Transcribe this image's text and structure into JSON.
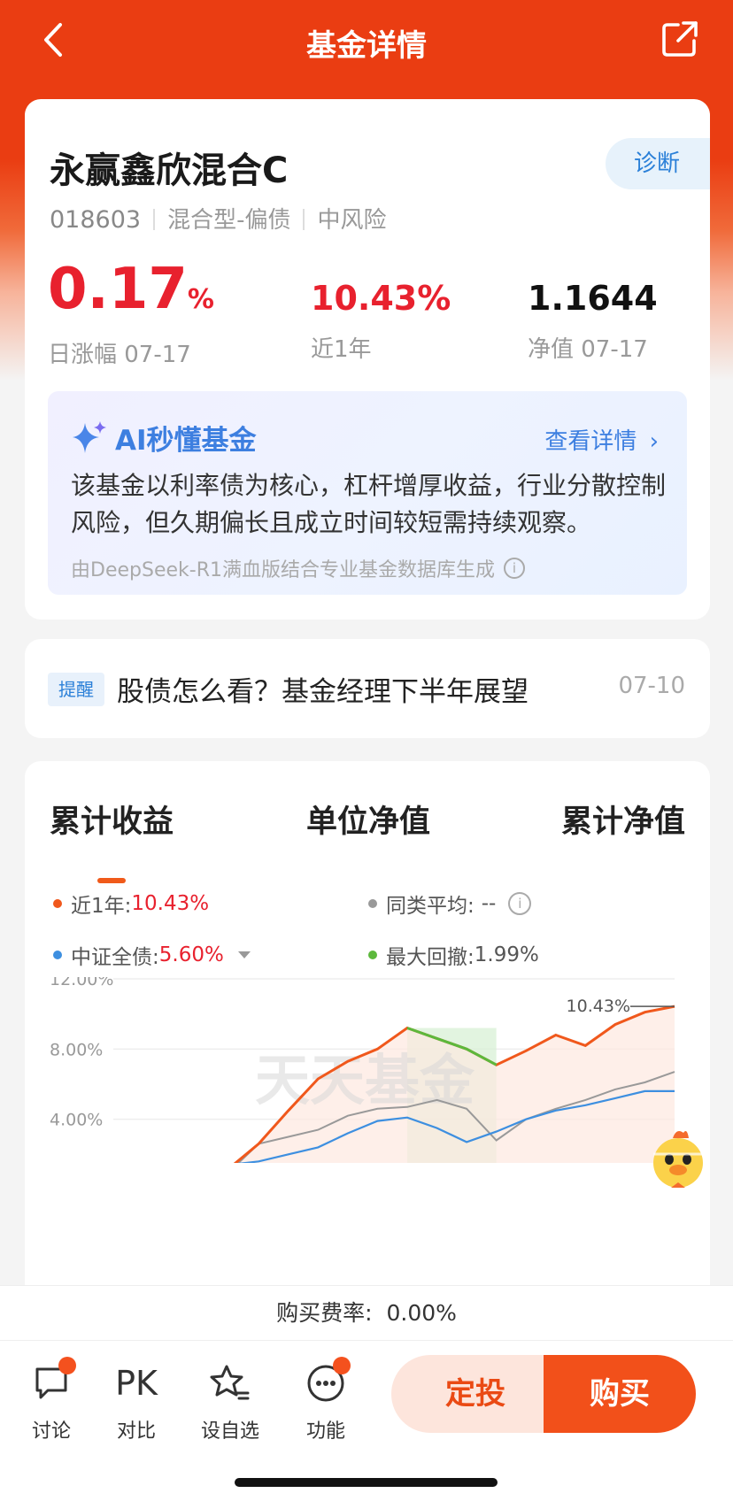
{
  "nav": {
    "title": "基金详情",
    "back_icon": "chevron-left-icon",
    "share_icon": "share-icon"
  },
  "fund": {
    "name": "永赢鑫欣混合C",
    "diagnose_label": "诊断",
    "code": "018603",
    "type": "混合型-偏债",
    "risk": "中风险",
    "daily_change": "0.17",
    "daily_change_unit": "%",
    "daily_change_label": "日涨幅 07-17",
    "year_return": "10.43%",
    "year_return_label": "近1年",
    "nav": "1.1644",
    "nav_label": "净值 07-17"
  },
  "ai": {
    "title": "AI秒懂基金",
    "more": "查看详情",
    "desc": "该基金以利率债为核心，杠杆增厚收益，行业分散控制风险，但久期偏长且成立时间较短需持续观察。",
    "footer": "由DeepSeek-R1满血版结合专业基金数据库生成"
  },
  "remind": {
    "tag": "提醒",
    "text": "股债怎么看？基金经理下半年展望",
    "date": "07-10"
  },
  "chart_tabs": [
    "累计收益",
    "单位净值",
    "累计净值"
  ],
  "legend": {
    "fund_label": "近1年:",
    "fund_value": "10.43%",
    "peer_label": "同类平均:",
    "peer_value": "--",
    "index_label": "中证全债:",
    "index_value": "5.60%",
    "drawdown_label": "最大回撤:",
    "drawdown_value": "1.99%"
  },
  "colors": {
    "brand": "#ea3d12",
    "fund_line": "#f0581c",
    "index_line": "#3d8fe0",
    "peer_line": "#999999",
    "drawdown": "#5cb83c",
    "up": "#e8212e"
  },
  "chart_data": {
    "type": "line",
    "y_ticks": [
      "12.00%",
      "8.00%",
      "4.00%"
    ],
    "ylim": [
      0,
      12
    ],
    "end_label": "10.43%",
    "watermark": "天天基金",
    "series": [
      {
        "name": "近1年",
        "values": [
          0.0,
          0.3,
          0.6,
          1.2,
          2.6,
          4.5,
          6.3,
          7.3,
          8.0,
          9.2,
          8.6,
          8.0,
          7.1,
          7.9,
          8.8,
          8.2,
          9.4,
          10.1,
          10.43
        ]
      },
      {
        "name": "同类平均",
        "values": [
          0.0,
          0.2,
          0.5,
          1.0,
          2.6,
          3.0,
          3.4,
          4.2,
          4.6,
          4.7,
          5.1,
          4.6,
          2.8,
          4.0,
          4.6,
          5.1,
          5.7,
          6.1,
          6.7
        ]
      },
      {
        "name": "中证全债",
        "values": [
          0.0,
          0.3,
          0.7,
          1.4,
          1.6,
          2.0,
          2.4,
          3.2,
          3.9,
          4.1,
          3.5,
          2.7,
          3.3,
          4.0,
          4.5,
          4.8,
          5.2,
          5.6,
          5.6
        ]
      }
    ],
    "drawdown_range": [
      9,
      12
    ]
  },
  "fee": {
    "label": "购买费率:",
    "value": "0.00%"
  },
  "bottom": {
    "discuss": "讨论",
    "compare_icon_text": "PK",
    "compare": "对比",
    "watchlist": "设自选",
    "functions": "功能",
    "dingtou": "定投",
    "buy": "购买"
  }
}
